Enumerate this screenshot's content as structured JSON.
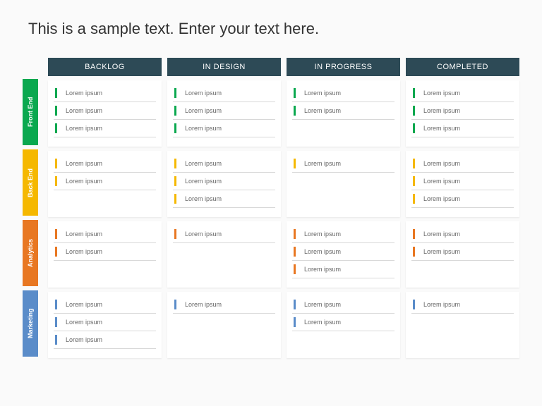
{
  "title": "This is a sample text. Enter your text here.",
  "columns": [
    "BACKLOG",
    "IN DESIGN",
    "IN PROGRESS",
    "COMPLETED"
  ],
  "rows": [
    {
      "label": "Front End",
      "color": "green"
    },
    {
      "label": "Back End",
      "color": "yellow"
    },
    {
      "label": "Analytics",
      "color": "orange"
    },
    {
      "label": "Marketing",
      "color": "blue"
    }
  ],
  "cells": [
    [
      [
        "Lorem ipsum",
        "Lorem ipsum",
        "Lorem ipsum"
      ],
      [
        "Lorem ipsum",
        "Lorem ipsum",
        "Lorem ipsum"
      ],
      [
        "Lorem ipsum",
        "Lorem ipsum"
      ],
      [
        "Lorem ipsum",
        "Lorem ipsum",
        "Lorem ipsum"
      ]
    ],
    [
      [
        "Lorem ipsum",
        "Lorem ipsum"
      ],
      [
        "Lorem ipsum",
        "Lorem ipsum",
        "Lorem ipsum"
      ],
      [
        "Lorem ipsum"
      ],
      [
        "Lorem ipsum",
        "Lorem ipsum",
        "Lorem ipsum"
      ]
    ],
    [
      [
        "Lorem ipsum",
        "Lorem ipsum"
      ],
      [
        "Lorem ipsum"
      ],
      [
        "Lorem ipsum",
        "Lorem ipsum",
        "Lorem ipsum"
      ],
      [
        "Lorem ipsum",
        "Lorem ipsum"
      ]
    ],
    [
      [
        "Lorem ipsum",
        "Lorem ipsum",
        "Lorem ipsum"
      ],
      [
        "Lorem ipsum"
      ],
      [
        "Lorem ipsum",
        "Lorem ipsum"
      ],
      [
        "Lorem ipsum"
      ]
    ]
  ]
}
